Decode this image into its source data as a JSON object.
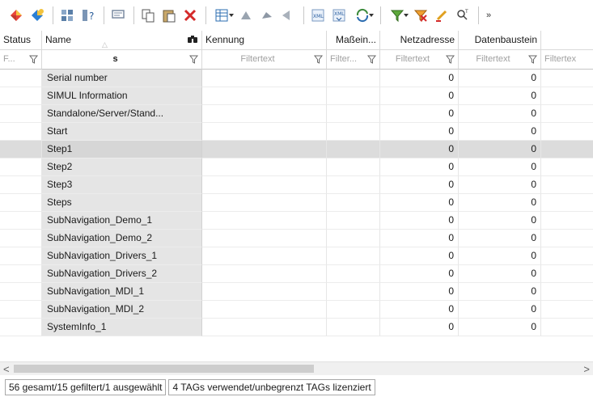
{
  "toolbar": {
    "icons": [
      "new-tag-icon",
      "new-structure-icon",
      "rename-icon",
      "tag-info-icon",
      "comment-icon",
      "copy-icon",
      "paste-icon",
      "delete-icon",
      "columns-icon",
      "tool-a-icon",
      "tool-b-icon",
      "tool-c-icon",
      "xml-export-icon",
      "xml-import-icon",
      "sync-icon",
      "filter-icon",
      "clear-filter-icon",
      "edit-icon",
      "find-icon"
    ],
    "more": "»"
  },
  "grid": {
    "columns": {
      "status": "Status",
      "name": "Name",
      "kennung": "Kennung",
      "mass": "Maßein...",
      "netz": "Netzadresse",
      "dat": "Datenbaustein"
    },
    "filters": {
      "status": "F...",
      "name": "s",
      "kennung": "Filtertext",
      "mass": "Filter...",
      "netz": "Filtertext",
      "dat": "Filtertext",
      "rest": "Filtertex"
    },
    "rows": [
      {
        "name": "Serial number",
        "netz": "0",
        "dat": "0"
      },
      {
        "name": "SIMUL Information",
        "netz": "0",
        "dat": "0"
      },
      {
        "name": "Standalone/Server/Stand...",
        "netz": "0",
        "dat": "0"
      },
      {
        "name": "Start",
        "netz": "0",
        "dat": "0"
      },
      {
        "name": "Step1",
        "netz": "0",
        "dat": "0"
      },
      {
        "name": "Step2",
        "netz": "0",
        "dat": "0"
      },
      {
        "name": "Step3",
        "netz": "0",
        "dat": "0"
      },
      {
        "name": "Steps",
        "netz": "0",
        "dat": "0"
      },
      {
        "name": "SubNavigation_Demo_1",
        "netz": "0",
        "dat": "0"
      },
      {
        "name": "SubNavigation_Demo_2",
        "netz": "0",
        "dat": "0"
      },
      {
        "name": "SubNavigation_Drivers_1",
        "netz": "0",
        "dat": "0"
      },
      {
        "name": "SubNavigation_Drivers_2",
        "netz": "0",
        "dat": "0"
      },
      {
        "name": "SubNavigation_MDI_1",
        "netz": "0",
        "dat": "0"
      },
      {
        "name": "SubNavigation_MDI_2",
        "netz": "0",
        "dat": "0"
      },
      {
        "name": "SystemInfo_1",
        "netz": "0",
        "dat": "0"
      }
    ],
    "selected_row": 4
  },
  "scrollbar": {
    "left": "<",
    "right": ">"
  },
  "statusbar": {
    "counts": "56 gesamt/15 gefiltert/1 ausgewählt",
    "license": "4 TAGs verwendet/unbegrenzt TAGs lizenziert"
  }
}
